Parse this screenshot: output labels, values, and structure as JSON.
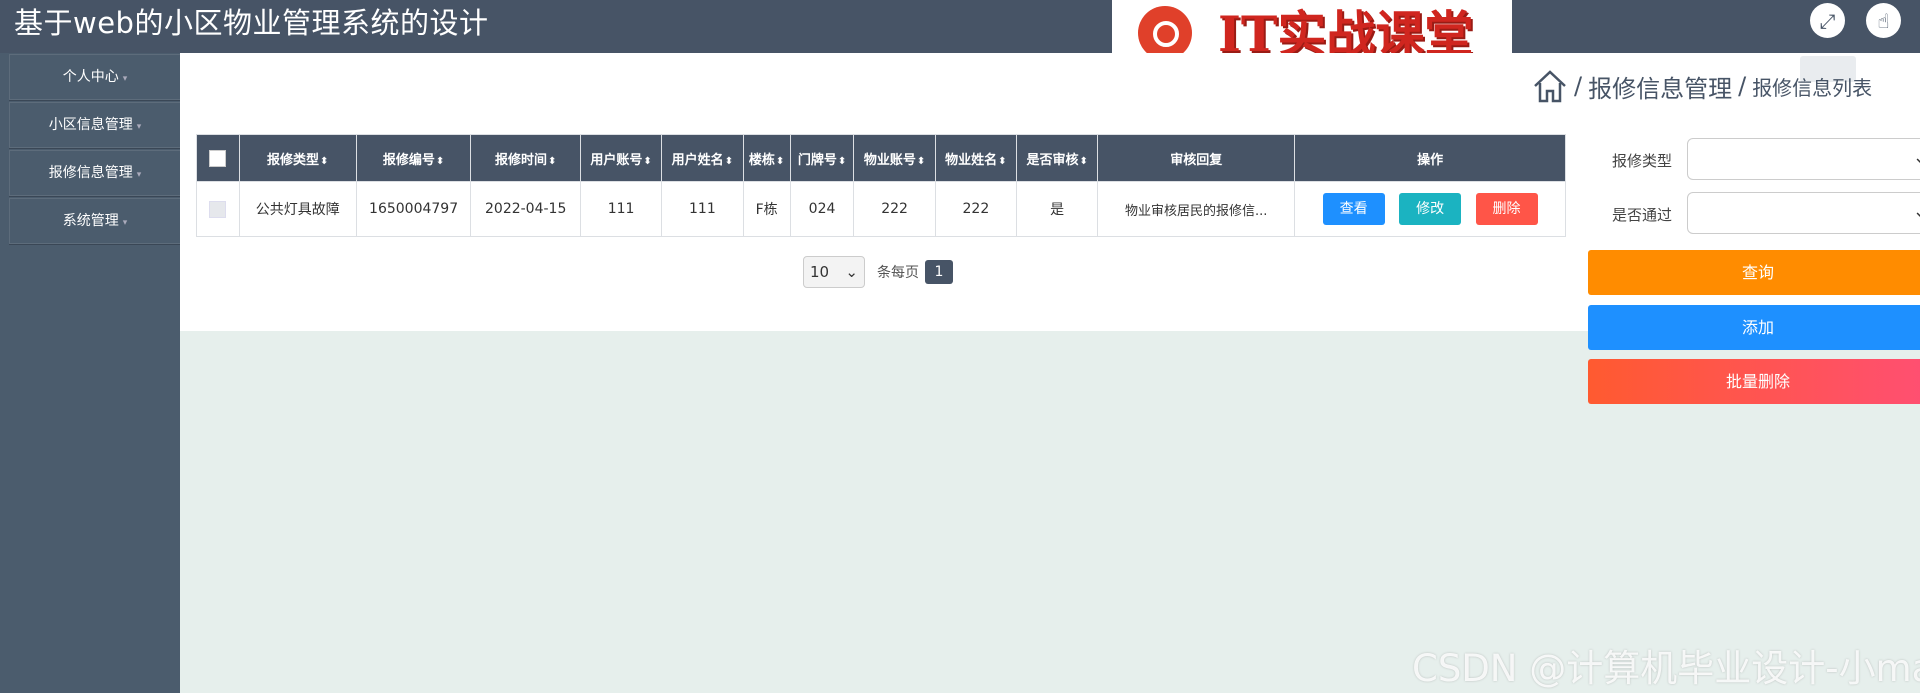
{
  "app": {
    "title": "基于web的小区物业管理系统的设计"
  },
  "logo": {
    "text": "IT实战课堂"
  },
  "header": {
    "fullscreen_icon": "expand-icon",
    "cursor_icon": "hand-pointer-icon"
  },
  "sidebar": {
    "items": [
      {
        "label": "个人中心"
      },
      {
        "label": "小区信息管理"
      },
      {
        "label": "报修信息管理"
      },
      {
        "label": "系统管理"
      }
    ]
  },
  "breadcrumb": {
    "home_icon": "home-icon",
    "sep": "/",
    "section": "报修信息管理",
    "current": "报修信息列表"
  },
  "table": {
    "columns": [
      "报修类型",
      "报修编号",
      "报修时间",
      "用户账号",
      "用户姓名",
      "楼栋",
      "门牌号",
      "物业账号",
      "物业姓名",
      "是否审核",
      "审核回复",
      "操作"
    ],
    "rows": [
      {
        "type": "公共灯具故障",
        "number": "1650004797",
        "time": "2022-04-15",
        "user_account": "111",
        "user_name": "111",
        "building": "F栋",
        "door": "024",
        "property_account": "222",
        "property_name": "222",
        "reviewed": "是",
        "reply": "物业审核居民的报修信...",
        "actions": {
          "view": "查看",
          "edit": "修改",
          "delete": "删除"
        }
      }
    ]
  },
  "pagination": {
    "page_size": "10",
    "per_page_label": "条每页",
    "current_page": "1"
  },
  "filters": {
    "type_label": "报修类型",
    "type_value": "",
    "passed_label": "是否通过",
    "passed_value": ""
  },
  "buttons": {
    "search": "查询",
    "add": "添加",
    "batch_delete": "批量删除"
  },
  "watermark": "CSDN @计算机毕业设计-小ma",
  "colors": {
    "header": "#475466",
    "sidebar": "#4b5c6d",
    "search": "#ff8c00",
    "add": "#1e90ff",
    "delete": "#ff5548",
    "edit": "#1bb3c1"
  }
}
